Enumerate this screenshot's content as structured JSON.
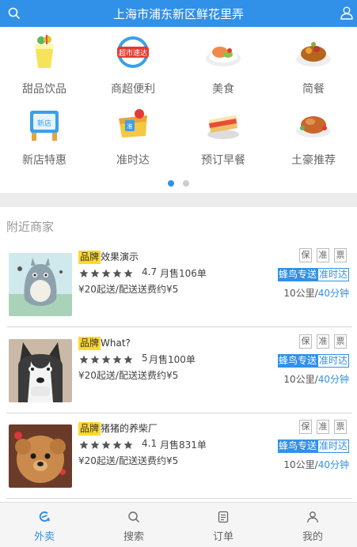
{
  "header": {
    "title": "上海市浦东新区鲜花里弄",
    "search_icon": "search-icon",
    "user_icon": "user-icon",
    "background": "#3190e8"
  },
  "categories": [
    {
      "label": "甜品饮品",
      "icon": "drink-icon"
    },
    {
      "label": "商超便利",
      "icon": "supermarket-icon"
    },
    {
      "label": "美食",
      "icon": "food-plate-icon"
    },
    {
      "label": "简餐",
      "icon": "simple-meal-icon"
    },
    {
      "label": "新店特惠",
      "icon": "new-store-icon"
    },
    {
      "label": "准时达",
      "icon": "on-time-icon"
    },
    {
      "label": "预订早餐",
      "icon": "breakfast-icon"
    },
    {
      "label": "土豪推荐",
      "icon": "roast-chicken-icon"
    }
  ],
  "carousel": {
    "pages": 2,
    "active": 1
  },
  "nearby": {
    "title": "附近商家",
    "shops": [
      {
        "brand": "品牌",
        "name": "效果演示",
        "stars": 5,
        "rating": "4.7",
        "sales": "月售106单",
        "delivery": "¥20起送/配送送费约¥5",
        "badges": [
          "保",
          "准",
          "票"
        ],
        "tag_primary": "蜂鸟专送",
        "tag_secondary": "准时达",
        "distance": "10公里/",
        "time": "40分钟",
        "thumb": "totoro-image"
      },
      {
        "brand": "品牌",
        "name": "What?",
        "stars": 5,
        "rating": "5",
        "sales": "月售100单",
        "delivery": "¥20起送/配送送费约¥5",
        "badges": [
          "保",
          "准",
          "票"
        ],
        "tag_primary": "蜂鸟专送",
        "tag_secondary": "准时达",
        "distance": "10公里/",
        "time": "40分钟",
        "thumb": "husky-image"
      },
      {
        "brand": "品牌",
        "name": "猪猪的养柴厂",
        "stars": 5,
        "rating": "4.1",
        "sales": "月售831单",
        "delivery": "¥20起送/配送送费约¥5",
        "badges": [
          "保",
          "准",
          "票"
        ],
        "tag_primary": "蜂鸟专送",
        "tag_secondary": "准时达",
        "distance": "10公里/",
        "time": "40分钟",
        "thumb": "puppy-image"
      }
    ]
  },
  "tabbar": [
    {
      "label": "外卖",
      "icon": "eleme-icon",
      "active": true
    },
    {
      "label": "搜索",
      "icon": "search-icon",
      "active": false
    },
    {
      "label": "订单",
      "icon": "order-icon",
      "active": false
    },
    {
      "label": "我的",
      "icon": "profile-icon",
      "active": false
    }
  ],
  "colors": {
    "accent": "#3190e8",
    "brand_badge": "#ffd930",
    "gap": "#ececec"
  }
}
